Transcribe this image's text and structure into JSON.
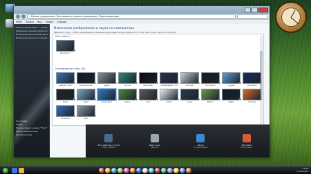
{
  "window": {
    "crumbs": "« Панель управления » Все элементы панели управления » Персонализация",
    "menu": [
      "Файл",
      "Правка",
      "Вид",
      "Сервис",
      "Справка"
    ]
  },
  "sidepane": {
    "links": [
      "Панель управления — домашняя страница",
      "Изменение значков рабочего стола",
      "Изменение указателей мыши",
      "Изменение рисунка учетной записи"
    ],
    "see_also": [
      "См. также",
      "Экран",
      "Панель задач и меню \"Пуск\"",
      "Центр специальных возможностей"
    ]
  },
  "content": {
    "title": "Изменение изображения и звука на компьютере",
    "subtitle": "Выберите тему, чтобы одновременно изменить фоновый рисунок рабочего стола, цвет окна, звуки и заставку.",
    "my_themes_label": "Мои темы (1)",
    "installed_label": "Установленные темы (28)",
    "my_theme": {
      "name": "Windows 7",
      "color": "#4a5a6a"
    },
    "themes": [
      {
        "name": "Abstract Cool",
        "color": "#3b6fb3"
      },
      {
        "name": "Aero Dark Blu",
        "color": "#101820"
      },
      {
        "name": "Apple",
        "color": "#8a8f94"
      },
      {
        "name": "Aurora",
        "color": "#2d8a74"
      },
      {
        "name": "Black Mac",
        "color": "#0a0a0a"
      },
      {
        "name": "CODEGRAPHY 3D",
        "color": "#2a2f4a"
      },
      {
        "name": "Concept",
        "color": "#c8ccd0"
      },
      {
        "name": "Concept 2",
        "color": "#1c1c1c"
      },
      {
        "name": "Crystal",
        "color": "#5ea0d8"
      },
      {
        "name": "Dark Blue",
        "color": "#1a2a5a"
      },
      {
        "name": "Dark",
        "color": "#222222"
      },
      {
        "name": "Glass",
        "color": "#7aa8c8"
      },
      {
        "name": "Glass Blue",
        "color": "#3a78b8"
      },
      {
        "name": "Green",
        "color": "#4a8a3a"
      },
      {
        "name": "Lens",
        "color": "#5a5a5a"
      },
      {
        "name": "Light",
        "color": "#e8eef2"
      },
      {
        "name": "Logo",
        "color": "#2a3a4a"
      },
      {
        "name": "Nature",
        "color": "#6a9a4a"
      },
      {
        "name": "Night",
        "color": "#0f1a2a"
      },
      {
        "name": "Orange",
        "color": "#d86a2a"
      },
      {
        "name": "Windows",
        "color": "#3a6ab8"
      },
      {
        "name": "Zen",
        "color": "#8a9aa4"
      }
    ],
    "bottom": [
      {
        "title": "Фон рабочего стола",
        "subtitle": "Показ слайдов",
        "color": "#4a6a8a"
      },
      {
        "title": "Цвет окна",
        "subtitle": "Другой",
        "color": "#9aa6b0"
      },
      {
        "title": "Звуки",
        "subtitle": "По умолчанию",
        "color": "#3a8ad8"
      },
      {
        "title": "Заставка",
        "subtitle": "Отсутствует",
        "color": "#d85a3a"
      }
    ]
  },
  "taskbar": {
    "time": "13:08",
    "date": "12.01.2012",
    "lang": "RU"
  }
}
